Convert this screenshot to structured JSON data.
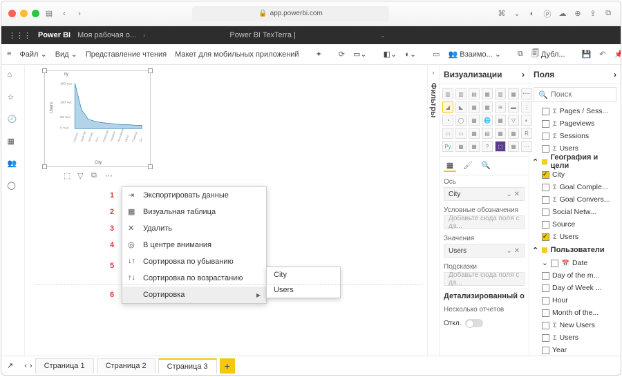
{
  "browser": {
    "url": "app.powerbi.com"
  },
  "titlebar": {
    "app": "Power BI",
    "workspace": "Моя рабочая о...",
    "report": "Power BI TexTerra |"
  },
  "ribbon": {
    "file": "Файл",
    "view": "Вид",
    "reading": "Представление чтения",
    "mobile": "Макет для мобильных приложений",
    "collab": "Взаимо...",
    "dup": "Дубл...",
    "pin": "Закрепит..."
  },
  "chart_data": {
    "type": "area",
    "title": "ity",
    "xlabel": "City",
    "ylabel": "Users",
    "yticks": [
      "160 тыс.",
      "100 тыс.",
      "50 тыс.",
      "0 тыс."
    ],
    "categories": [
      "Moscow",
      "Saint Pet.",
      "(not set)",
      "Kiev",
      "Krasnodar",
      "Yekaterinb.",
      "Novosibirsk",
      "Minsk",
      "Frankfurt",
      "Он"
    ],
    "values": [
      160,
      60,
      30,
      25,
      22,
      20,
      18,
      16,
      15,
      14
    ]
  },
  "ctx": {
    "items": [
      {
        "n": "1",
        "label": "Экспортировать данные"
      },
      {
        "n": "2",
        "label": "Визуальная таблица"
      },
      {
        "n": "3",
        "label": "Удалить"
      },
      {
        "n": "4",
        "label": "В центре внимания"
      },
      {
        "n": "5a",
        "label": "Сортировка по убыванию"
      },
      {
        "n": "5b",
        "label": "Сортировка по возрастанию"
      },
      {
        "n": "6",
        "label": "Сортировка"
      }
    ],
    "submenu": [
      "City",
      "Users"
    ]
  },
  "filters_label": "Фильтры",
  "vis": {
    "title": "Визуализации",
    "axis": "Ось",
    "axis_val": "City",
    "legend": "Условные обозначения",
    "legend_ph": "Добавьте сюда поля с да...",
    "values": "Значения",
    "values_val": "Users",
    "tooltips": "Подсказки",
    "tooltips_ph": "Добавьте сюда поля с да...",
    "drill": "Детализированный о",
    "cross": "Несколько отчетов",
    "off": "Откл."
  },
  "fields": {
    "title": "Поля",
    "search_ph": "Поиск",
    "t1": [
      {
        "label": "Pages / Sess...",
        "sigma": true
      },
      {
        "label": "Pageviews",
        "sigma": true
      },
      {
        "label": "Sessions",
        "sigma": true
      },
      {
        "label": "Users",
        "sigma": true
      }
    ],
    "g2": "География и цели",
    "t2": [
      {
        "label": "City",
        "on": true
      },
      {
        "label": "Goal Comple...",
        "sigma": true
      },
      {
        "label": "Goal Convers...",
        "sigma": true
      },
      {
        "label": "Social Netw..."
      },
      {
        "label": "Source"
      },
      {
        "label": "Users",
        "sigma": true,
        "on": true
      }
    ],
    "g3": "Пользователи",
    "t3_date": "Date",
    "t3": [
      {
        "label": "Day of the m..."
      },
      {
        "label": "Day of Week ..."
      },
      {
        "label": "Hour"
      },
      {
        "label": "Month of the..."
      },
      {
        "label": "New Users",
        "sigma": true
      },
      {
        "label": "Users",
        "sigma": true
      },
      {
        "label": "Year"
      }
    ]
  },
  "tabs": {
    "p1": "Страница 1",
    "p2": "Страница 2",
    "p3": "Страница 3"
  }
}
